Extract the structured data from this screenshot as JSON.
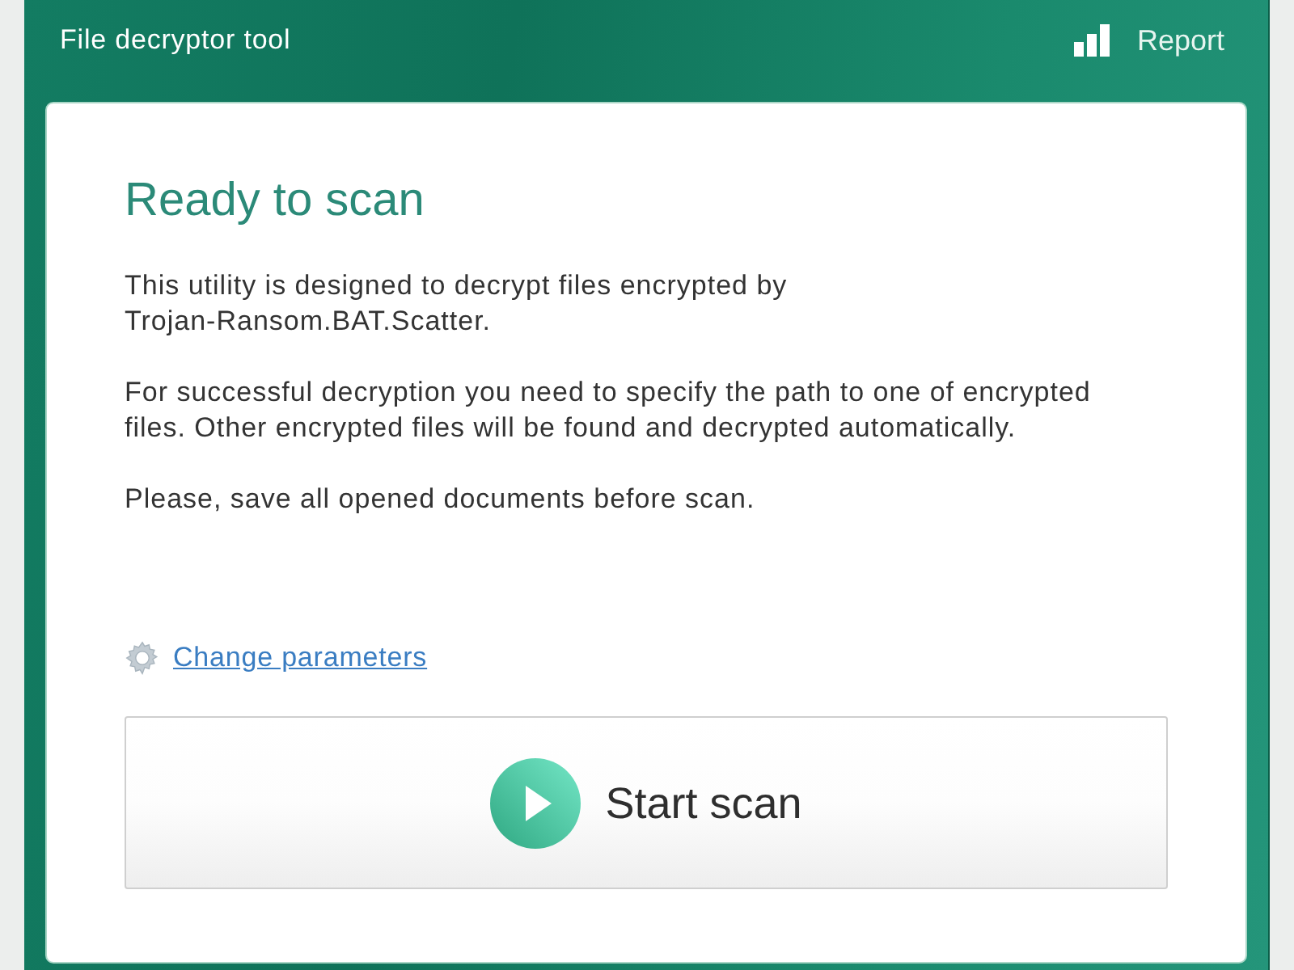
{
  "window": {
    "subtitle": "File decryptor tool",
    "report_link": "Report"
  },
  "panel": {
    "heading": "Ready to scan",
    "paragraphs": [
      "This utility is designed to decrypt files encrypted by\nTrojan-Ransom.BAT.Scatter.",
      "For successful decryption you need to specify the path to one of encrypted\nfiles. Other encrypted files will be found and decrypted automatically.",
      "Please, save all opened documents before scan."
    ],
    "settings_link": "Change parameters",
    "start_button": "Start scan"
  }
}
